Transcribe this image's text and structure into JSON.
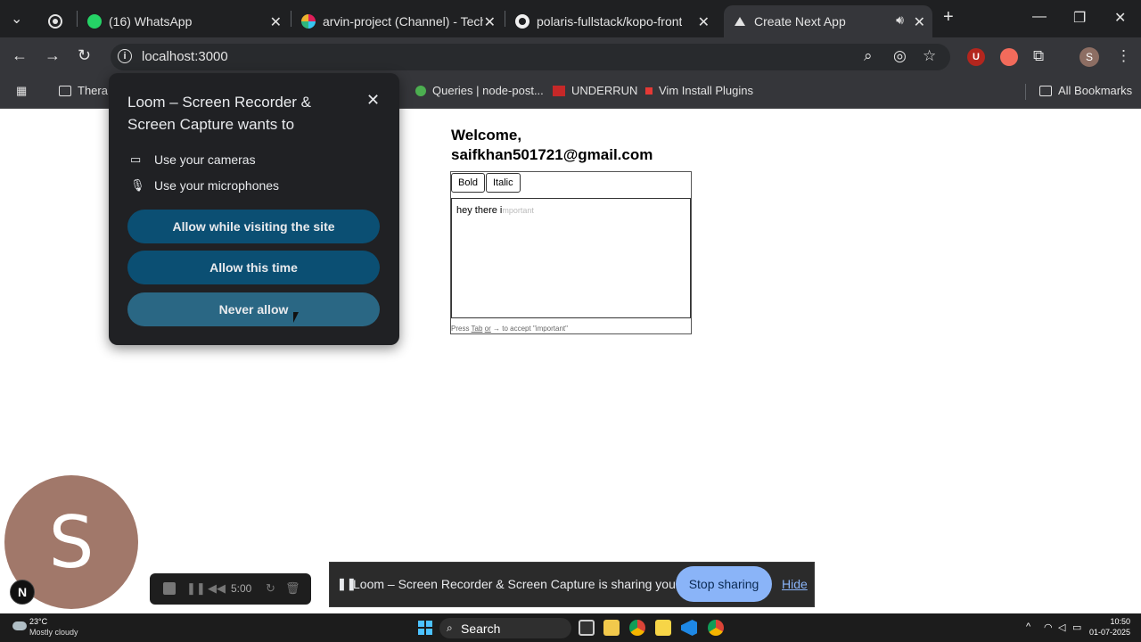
{
  "browser": {
    "tabs": [
      {
        "title": "(16) WhatsApp",
        "favicon": "whatsapp-icon",
        "badge": "16"
      },
      {
        "title": "arvin-project (Channel) - TechFi",
        "favicon": "slack-icon"
      },
      {
        "title": "polaris-fullstack/kopo-front",
        "favicon": "github-icon"
      },
      {
        "title": "Create Next App",
        "favicon": "nextjs-icon",
        "active": true
      }
    ],
    "address": "localhost:3000",
    "bookmarks": [
      {
        "label": "Thera"
      },
      {
        "label": "Queries | node-post..."
      },
      {
        "label": "UNDERRUN"
      },
      {
        "label": "Vim Install Plugins"
      },
      {
        "label": "All Bookmarks"
      }
    ],
    "profile_initial": "S",
    "extension_initial": "U"
  },
  "page": {
    "welcome_line1": "Welcome,",
    "welcome_line2": "saifkhan501721@gmail.com",
    "editor": {
      "bold_label": "Bold",
      "italic_label": "Italic",
      "typed_text": "hey there i",
      "suggestion": "mportant",
      "hint_press": "Press",
      "hint_tab": "Tab",
      "hint_or": "or",
      "hint_arrow": "→",
      "hint_accept": "to accept \"important\""
    }
  },
  "permission_popup": {
    "title": "Loom – Screen Recorder & Screen Capture wants to",
    "permissions": [
      {
        "label": "Use your cameras",
        "icon": "camera-icon"
      },
      {
        "label": "Use your microphones",
        "icon": "microphone-icon"
      }
    ],
    "buttons": {
      "allow_visiting": "Allow while visiting the site",
      "allow_once": "Allow this time",
      "never": "Never allow"
    }
  },
  "loom": {
    "avatar_initial": "S",
    "n_badge": "N",
    "timer": "5:00",
    "sharing_text": "Loom – Screen Recorder & Screen Capture is sharing your screen.",
    "stop_label": "Stop sharing",
    "hide_label": "Hide"
  },
  "taskbar": {
    "temperature": "23°C",
    "condition": "Mostly cloudy",
    "search_label": "Search",
    "time": "10:50",
    "date": "01-07-2025"
  },
  "colors": {
    "popup_bg": "#202124",
    "popup_button": "#0b4f73",
    "stop_sharing": "#8ab4f8",
    "avatar": "#a1786a"
  }
}
